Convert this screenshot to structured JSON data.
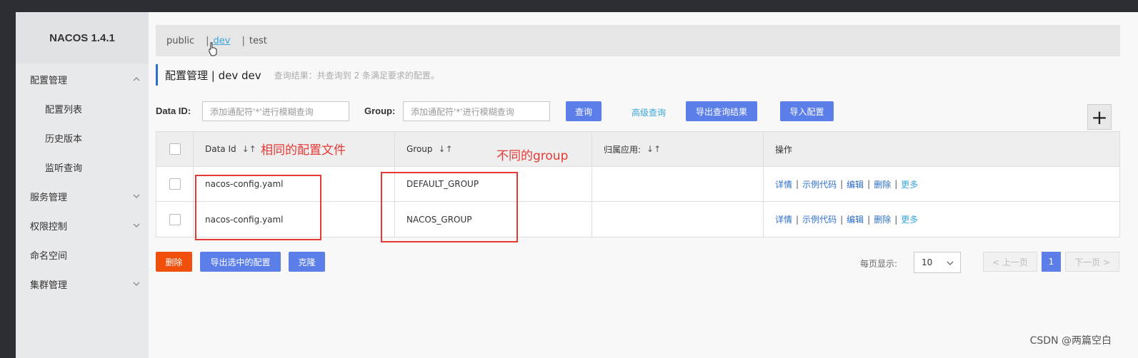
{
  "app": {
    "title": "NACOS 1.4.1"
  },
  "sidebar": {
    "items": [
      {
        "label": "配置管理",
        "expanded": true
      },
      {
        "label": "配置列表"
      },
      {
        "label": "历史版本"
      },
      {
        "label": "监听查询"
      },
      {
        "label": "服务管理",
        "expanded": false
      },
      {
        "label": "权限控制",
        "expanded": false
      },
      {
        "label": "命名空间"
      },
      {
        "label": "集群管理",
        "expanded": false
      }
    ]
  },
  "namespaces": {
    "items": [
      "public",
      "dev",
      "test"
    ],
    "active": "dev",
    "sep": "|"
  },
  "page": {
    "title": "配置管理 | dev dev",
    "result_text": "查询结果：共查询到 2 条满足要求的配置。"
  },
  "search": {
    "data_id_label": "Data ID:",
    "data_id_placeholder": "添加通配符'*'进行模糊查询",
    "group_label": "Group:",
    "group_placeholder": "添加通配符'*'进行模糊查询",
    "query_button": "查询",
    "advanced_link": "高级查询",
    "export_button": "导出查询结果",
    "import_button": "导入配置",
    "plus": "+"
  },
  "table": {
    "columns": [
      "Data Id",
      "Group",
      "归属应用:",
      "操作"
    ],
    "sort_icon": "↓↑",
    "rows": [
      {
        "data_id": "nacos-config.yaml",
        "group": "DEFAULT_GROUP",
        "app": ""
      },
      {
        "data_id": "nacos-config.yaml",
        "group": "NACOS_GROUP",
        "app": ""
      }
    ],
    "ops": {
      "detail": "详情",
      "sample": "示例代码",
      "edit": "编辑",
      "delete": "删除",
      "more": "更多",
      "sep": "|"
    }
  },
  "annotations": {
    "same_file": "相同的配置文件",
    "diff_group": "不同的group"
  },
  "bottom": {
    "delete_button": "删除",
    "export_selected_button": "导出选中的配置",
    "clone_button": "克隆",
    "page_size_label": "每页显示:",
    "page_size_value": "10",
    "prev": "< 上一页",
    "current_page": "1",
    "next": "下一页 >"
  },
  "watermark": "CSDN @两篇空白",
  "colors": {
    "primary": "#5b7ee9",
    "danger": "#f04e0b",
    "annotation": "#e53935",
    "link": "#2d6ec8"
  }
}
